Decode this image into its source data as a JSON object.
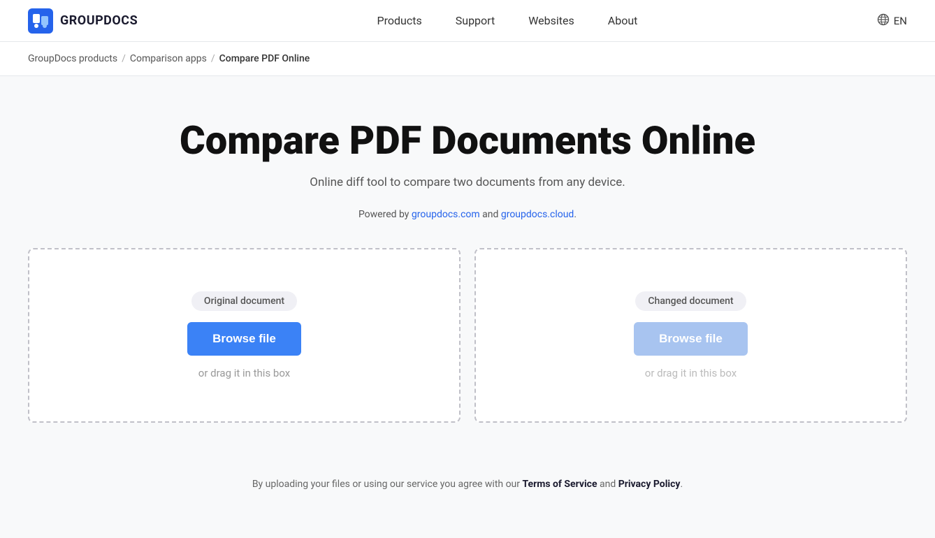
{
  "header": {
    "logo_text": "GROUPDOCS",
    "nav": {
      "items": [
        "Products",
        "Support",
        "Websites",
        "About"
      ]
    },
    "language": "EN"
  },
  "breadcrumb": {
    "items": [
      {
        "label": "GroupDocs products",
        "href": "#"
      },
      {
        "label": "Comparison apps",
        "href": "#"
      },
      {
        "label": "Compare PDF Online"
      }
    ]
  },
  "main": {
    "title": "Compare PDF Documents Online",
    "subtitle": "Online diff tool to compare two documents from any device.",
    "powered_by_prefix": "Powered by ",
    "powered_by_link1": "groupdocs.com",
    "powered_by_link1_href": "#",
    "powered_by_and": " and ",
    "powered_by_link2": "groupdocs.cloud",
    "powered_by_link2_href": "#",
    "powered_by_suffix": "."
  },
  "upload": {
    "left": {
      "label": "Original document",
      "button": "Browse file",
      "drag_text": "or drag it in this box"
    },
    "right": {
      "label": "Changed document",
      "button": "Browse file",
      "drag_text": "or drag it in this box"
    }
  },
  "footer": {
    "text_prefix": "By uploading your files or using our service you agree with our ",
    "tos_label": "Terms of Service",
    "tos_href": "#",
    "and_text": " and ",
    "privacy_label": "Privacy Policy",
    "privacy_href": "#",
    "text_suffix": "."
  }
}
